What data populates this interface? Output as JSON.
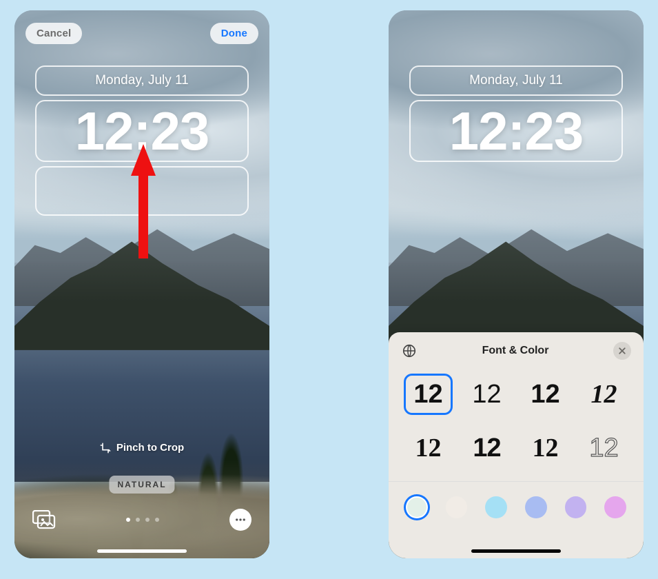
{
  "left": {
    "cancel_label": "Cancel",
    "done_label": "Done",
    "date": "Monday, July 11",
    "time": "12:23",
    "hint": "Pinch to Crop",
    "filter_label": "NATURAL",
    "pager": {
      "count": 4,
      "active": 0
    }
  },
  "right": {
    "date": "Monday, July 11",
    "time": "12:23",
    "sheet": {
      "title": "Font & Color",
      "font_sample": "12",
      "selected_font_index": 0,
      "colors": [
        "#e3f0e8",
        "#f1ece6",
        "#a5e0f5",
        "#a8bcf2",
        "#c2b2f0",
        "#e5a6ed"
      ],
      "selected_color_index": 0
    }
  },
  "icons": {
    "crop": "crop-icon",
    "gallery": "gallery-icon",
    "more": "more-icon",
    "globe": "globe-icon",
    "close": "close-icon"
  }
}
